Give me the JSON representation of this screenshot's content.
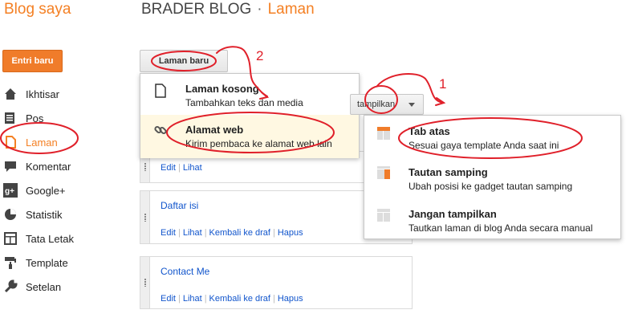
{
  "brand": "Blog saya",
  "header": {
    "blog_name": "BRADER BLOG",
    "separator": "·",
    "section": "Laman"
  },
  "new_post_button": "Entri baru",
  "sidebar": {
    "items": [
      {
        "label": "Ikhtisar",
        "icon": "home-icon"
      },
      {
        "label": "Pos",
        "icon": "posts-icon"
      },
      {
        "label": "Laman",
        "icon": "page-icon",
        "active": true
      },
      {
        "label": "Komentar",
        "icon": "comment-icon"
      },
      {
        "label": "Google+",
        "icon": "google-plus-icon"
      },
      {
        "label": "Statistik",
        "icon": "stats-icon"
      },
      {
        "label": "Tata Letak",
        "icon": "layout-icon"
      },
      {
        "label": "Template",
        "icon": "template-icon"
      },
      {
        "label": "Setelan",
        "icon": "settings-icon"
      }
    ]
  },
  "new_page_button": "Laman baru",
  "new_page_menu": [
    {
      "title": "Laman kosong",
      "desc": "Tambahkan teks dan media",
      "icon": "blank-page-icon"
    },
    {
      "title": "Alamat web",
      "desc": "Kirim pembaca ke alamat web lain",
      "icon": "link-icon"
    }
  ],
  "display_button": "Tampilkan",
  "display_button_visible": "tampilkan",
  "display_menu": [
    {
      "title": "Tab atas",
      "desc": "Sesuai gaya template Anda saat ini",
      "icon": "top-tabs-icon"
    },
    {
      "title": "Tautan samping",
      "desc": "Ubah posisi ke gadget tautan samping",
      "icon": "side-links-icon"
    },
    {
      "title": "Jangan tampilkan",
      "desc": "Tautkan laman di blog Anda secara manual",
      "icon": "hidden-icon"
    }
  ],
  "pages": [
    {
      "title": "",
      "actions": [
        "Edit",
        "Lihat"
      ]
    },
    {
      "title": "Daftar isi",
      "actions": [
        "Edit",
        "Lihat",
        "Kembali ke draf",
        "Hapus"
      ]
    },
    {
      "title": "Contact Me",
      "actions": [
        "Edit",
        "Lihat",
        "Kembali ke draf",
        "Hapus"
      ]
    }
  ],
  "annotations": {
    "step1": "1",
    "step2": "2"
  },
  "colors": {
    "accent": "#f48024",
    "link": "#1155cc",
    "annotation": "#e0202a"
  }
}
